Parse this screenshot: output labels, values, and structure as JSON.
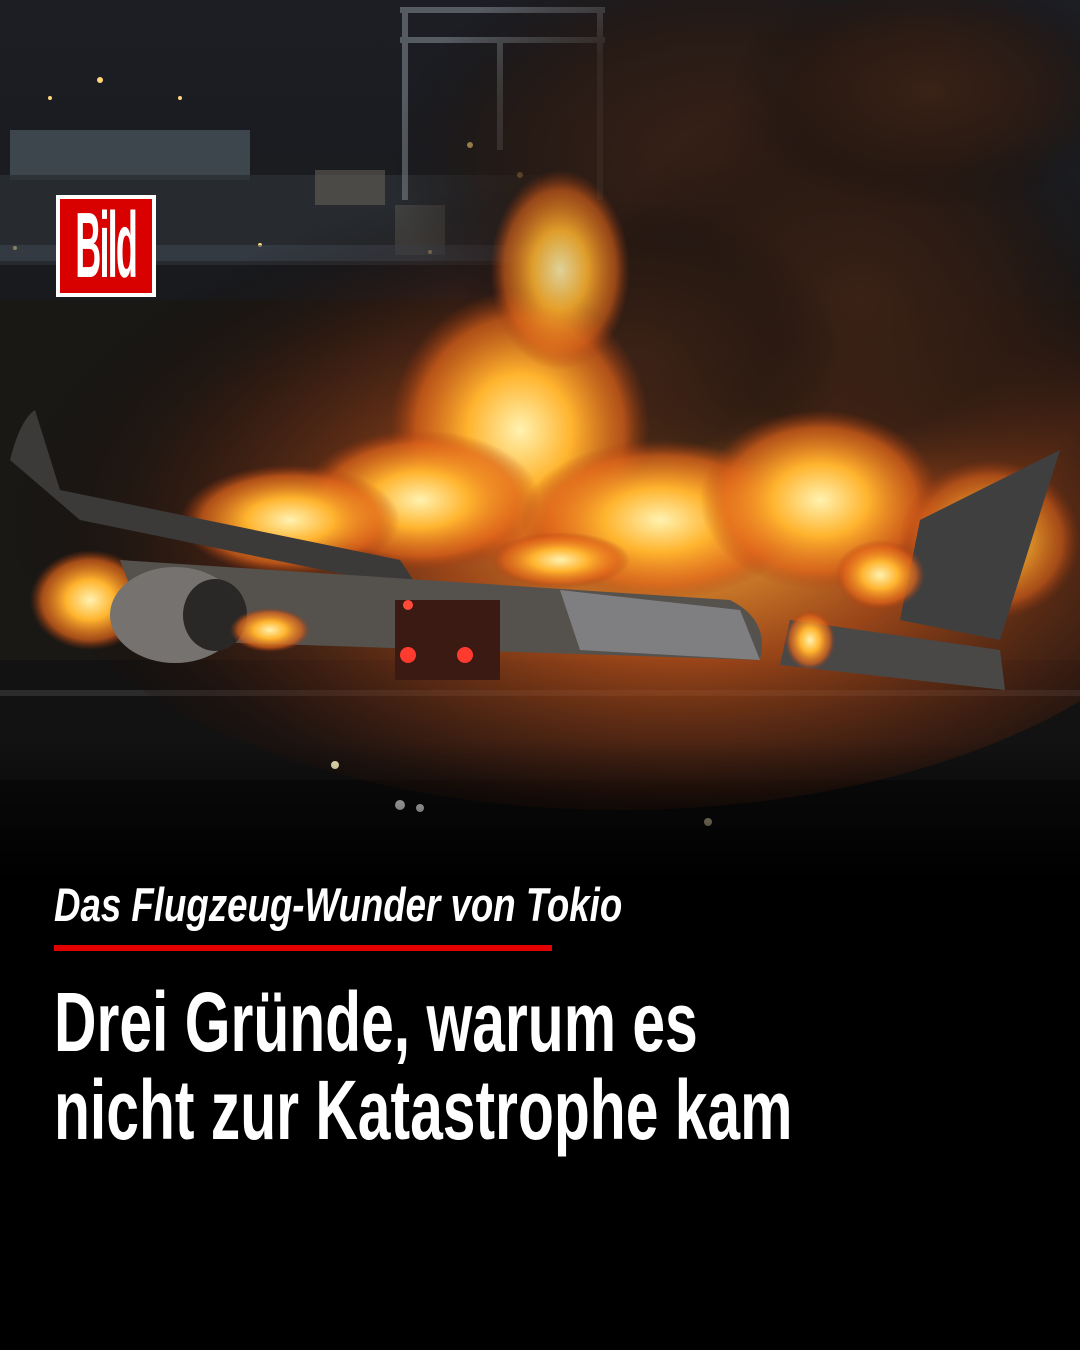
{
  "brand": {
    "logo_text": "Bild",
    "logo_color": "#d90000"
  },
  "kicker": "Das Flugzeug-Wunder von Tokio",
  "accent_color": "#e30000",
  "headline": {
    "line1": "Drei Gründe, warum es",
    "line2": "nicht zur Katastrophe kam"
  }
}
